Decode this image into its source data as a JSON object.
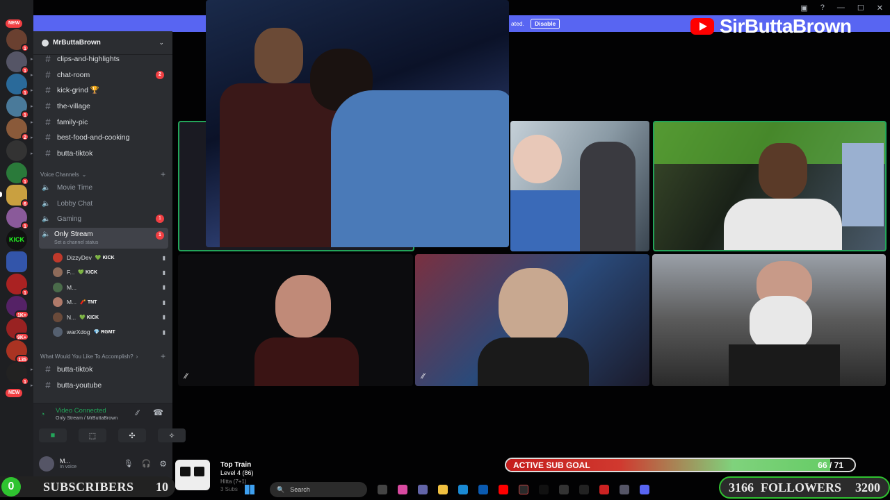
{
  "window": {
    "controls": [
      "inbox-icon",
      "help-icon",
      "minimize-icon",
      "maximize-icon",
      "close-icon"
    ]
  },
  "rail": {
    "new_label": "NEW",
    "badges": [
      "1",
      "1",
      "1",
      "1",
      "2",
      "1",
      "",
      "1",
      "2",
      "6",
      "1",
      "",
      "",
      "1",
      "",
      "",
      "1",
      "1K+",
      "9K+",
      "135",
      "1"
    ]
  },
  "banner": {
    "tail_text": "ated.",
    "disable_label": "Disable"
  },
  "youtube": {
    "channel": "SirButtaBrown"
  },
  "server": {
    "name": "MrButtaBrown"
  },
  "text_channels": [
    {
      "name": "clips-and-highlights",
      "badge": ""
    },
    {
      "name": "chat-room",
      "badge": "2"
    },
    {
      "name": "kick-grind 🏆",
      "badge": ""
    },
    {
      "name": "the-village",
      "badge": ""
    },
    {
      "name": "family-pic",
      "badge": ""
    },
    {
      "name": "best-food-and-cooking",
      "badge": ""
    },
    {
      "name": "butta-tiktok",
      "badge": ""
    }
  ],
  "voice_category": "Voice Channels",
  "voice_channels": [
    {
      "name": "Movie Time",
      "badge": ""
    },
    {
      "name": "Lobby Chat",
      "badge": ""
    },
    {
      "name": "Gaming",
      "badge": "1"
    }
  ],
  "active_voice": {
    "name": "Only Stream",
    "status": "Set a channel status",
    "badge": "1"
  },
  "voice_users": [
    {
      "name": "DizzyDev",
      "tag": "💚 KICK",
      "color": "#c0392b"
    },
    {
      "name": "F...",
      "tag": "💚 KICK",
      "color": "#8e6b5a"
    },
    {
      "name": "M...",
      "tag": "",
      "color": "#4a6b4a"
    },
    {
      "name": "M...",
      "tag": "🧨 TNT",
      "color": "#b07a6a"
    },
    {
      "name": "N...",
      "tag": "💚 KICK",
      "color": "#6a4a3a"
    },
    {
      "name": "warXdog",
      "tag": "💎 RGMT",
      "color": "#556070"
    }
  ],
  "category2": "What Would You Like To Accomplish?",
  "text_channels2": [
    {
      "name": "butta-tiktok"
    },
    {
      "name": "butta-youtube"
    }
  ],
  "video_panel": {
    "title": "Video Connected",
    "subtitle": "Only Stream / MrButtaBrown"
  },
  "user_bar": {
    "name": "M...",
    "status": "In voice"
  },
  "subscribers": {
    "current": "0",
    "label": "SUBSCRIBERS",
    "goal": "10"
  },
  "train": {
    "title": "Top Train",
    "level": "Level 4  (86)",
    "line3": "Hitta (7+1)",
    "line4": "3 Subs"
  },
  "sub_goal": {
    "label": "ACTIVE SUB GOAL",
    "current": 66,
    "target": 71,
    "text": "66 / 71"
  },
  "followers": {
    "current": "3166",
    "label": "FOLLOWERS",
    "goal": "3200"
  },
  "taskbar": {
    "search_placeholder": "Search"
  },
  "colors": {
    "accent": "#5865f2",
    "green": "#23a55a",
    "badge_red": "#f23f43"
  }
}
